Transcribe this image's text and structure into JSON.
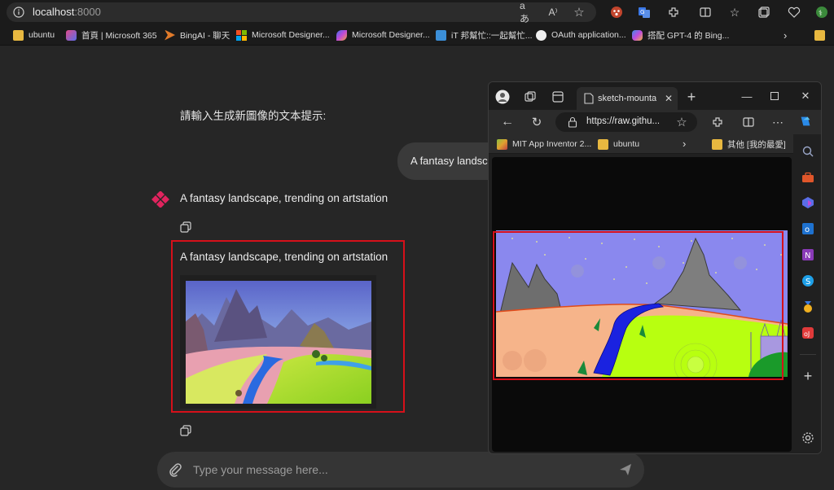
{
  "browser": {
    "url_host": "localhost",
    "url_port": ":8000"
  },
  "bookmarks": [
    {
      "label": "ubuntu",
      "icon": "folder-icon"
    },
    {
      "label": "首頁 | Microsoft 365",
      "icon": "m365-icon"
    },
    {
      "label": "BingAI - 聊天",
      "icon": "bing-icon"
    },
    {
      "label": "Microsoft Designer...",
      "icon": "microsoft-icon"
    },
    {
      "label": "Microsoft Designer...",
      "icon": "designer-icon"
    },
    {
      "label": "iT 邦幫忙::一起幫忙...",
      "icon": "ithelp-icon"
    },
    {
      "label": "OAuth application...",
      "icon": "github-icon"
    },
    {
      "label": "搭配 GPT-4 的 Bing...",
      "icon": "copilot-icon"
    }
  ],
  "chat": {
    "prompt_label": "請輸入生成新圖像的文本提示:",
    "user_message": "A fantasy landscape, trending on artstation",
    "bot_message": "A fantasy landscape, trending on artstation",
    "result_caption": "A fantasy landscape, trending on artstation",
    "input_placeholder": "Type your message here..."
  },
  "popup": {
    "tab_title": "sketch-mountains",
    "url": "https://raw.githu...",
    "bookmarks": [
      "MIT App Inventor 2...",
      "ubuntu",
      "其他 [我的最愛]"
    ]
  },
  "colors": {
    "accent_red": "#d6101a",
    "bot_icon": "#e0245e"
  }
}
